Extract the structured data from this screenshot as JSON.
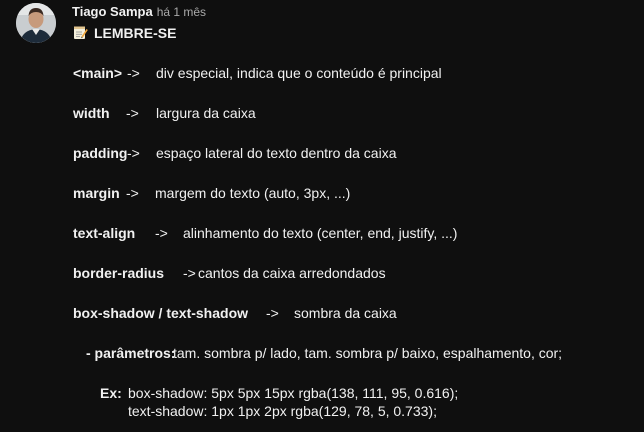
{
  "comment": {
    "author": "Tiago Sampa",
    "time": "há 1 mês",
    "title": "LEMBRE-SE",
    "title_icon": "memo-icon",
    "rows": [
      {
        "term": "<main>",
        "arrow": "->",
        "desc": "div especial, indica que o conteúdo é principal"
      },
      {
        "term": "width",
        "arrow": "->",
        "desc": "largura da caixa"
      },
      {
        "term": "padding",
        "arrow": "->",
        "desc": "espaço lateral do texto dentro da caixa"
      },
      {
        "term": "margin",
        "arrow": "->",
        "desc": "margem do texto (auto, 3px, ...)"
      },
      {
        "term": "text-align",
        "arrow": "->",
        "desc": "alinhamento do texto (center, end, justify, ...)"
      },
      {
        "term": "border-radius",
        "arrow": "->",
        "desc": "cantos da caixa arredondados"
      },
      {
        "term": "box-shadow / text-shadow",
        "arrow": "->",
        "desc": "sombra da caixa"
      }
    ],
    "params_label": "- parâmetros:",
    "params_text": "tam. sombra p/ lado, tam. sombra p/ baixo, espalhamento, cor;",
    "example_label": "Ex:",
    "example_line1": "box-shadow: 5px 5px 15px rgba(138, 111, 95, 0.616);",
    "example_line2": "text-shadow: 1px 1px 2px rgba(129, 78, 5, 0.733);"
  }
}
